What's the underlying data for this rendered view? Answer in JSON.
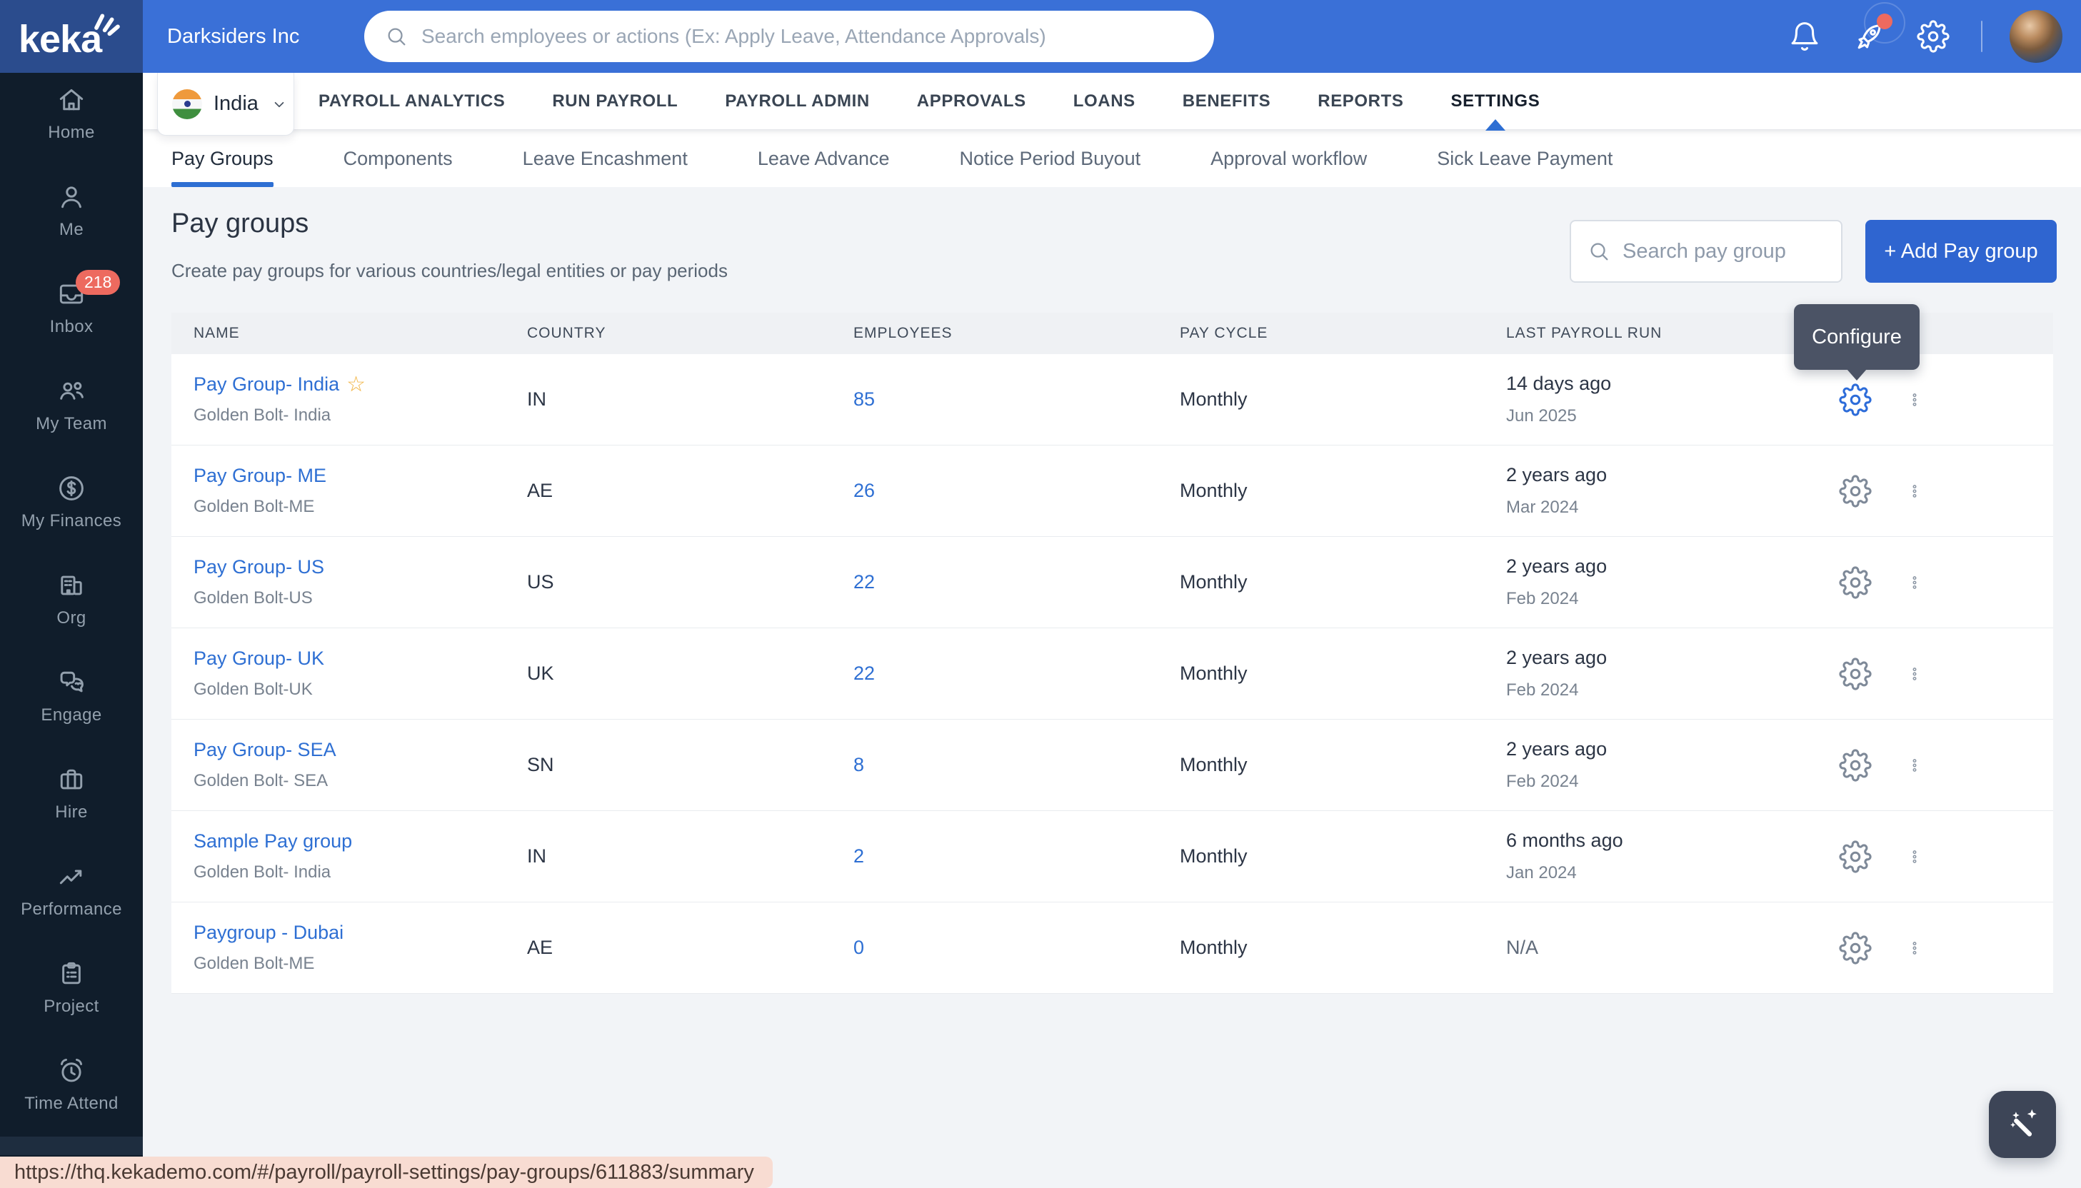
{
  "header": {
    "logo_text": "keka",
    "company_name": "Darksiders Inc",
    "search_placeholder": "Search employees or actions (Ex: Apply Leave, Attendance Approvals)"
  },
  "nav": {
    "region_selector": {
      "label": "India",
      "flag": "india-flag-icon"
    },
    "tabs": [
      "PAYROLL ANALYTICS",
      "RUN PAYROLL",
      "PAYROLL ADMIN",
      "APPROVALS",
      "LOANS",
      "BENEFITS",
      "REPORTS",
      "SETTINGS"
    ],
    "active_tab": "SETTINGS"
  },
  "subnav": {
    "tabs": [
      "Pay Groups",
      "Components",
      "Leave Encashment",
      "Leave Advance",
      "Notice Period Buyout",
      "Approval workflow",
      "Sick Leave Payment"
    ],
    "active_tab": "Pay Groups"
  },
  "page": {
    "title": "Pay groups",
    "subtitle": "Create pay groups for various countries/legal entities or pay periods",
    "search_placeholder": "Search pay group",
    "add_button_label": "+ Add Pay group"
  },
  "tooltip": {
    "label": "Configure"
  },
  "table": {
    "columns": [
      "NAME",
      "COUNTRY",
      "EMPLOYEES",
      "PAY CYCLE",
      "LAST PAYROLL RUN"
    ],
    "rows": [
      {
        "name": "Pay Group- India",
        "starred": true,
        "entity": "Golden Bolt- India",
        "country": "IN",
        "employees": "85",
        "pay_cycle": "Monthly",
        "last_run": "14 days ago",
        "last_run_period": "Jun 2025",
        "gear_active": true
      },
      {
        "name": "Pay Group- ME",
        "starred": false,
        "entity": "Golden Bolt-ME",
        "country": "AE",
        "employees": "26",
        "pay_cycle": "Monthly",
        "last_run": "2 years ago",
        "last_run_period": "Mar 2024",
        "gear_active": false
      },
      {
        "name": "Pay Group- US",
        "starred": false,
        "entity": "Golden Bolt-US",
        "country": "US",
        "employees": "22",
        "pay_cycle": "Monthly",
        "last_run": "2 years ago",
        "last_run_period": "Feb 2024",
        "gear_active": false
      },
      {
        "name": "Pay Group- UK",
        "starred": false,
        "entity": "Golden Bolt-UK",
        "country": "UK",
        "employees": "22",
        "pay_cycle": "Monthly",
        "last_run": "2 years ago",
        "last_run_period": "Feb 2024",
        "gear_active": false
      },
      {
        "name": "Pay Group- SEA",
        "starred": false,
        "entity": "Golden Bolt- SEA",
        "country": "SN",
        "employees": "8",
        "pay_cycle": "Monthly",
        "last_run": "2 years ago",
        "last_run_period": "Feb 2024",
        "gear_active": false
      },
      {
        "name": "Sample Pay group",
        "starred": false,
        "entity": "Golden Bolt- India",
        "country": "IN",
        "employees": "2",
        "pay_cycle": "Monthly",
        "last_run": "6 months ago",
        "last_run_period": "Jan 2024",
        "gear_active": false
      },
      {
        "name": "Paygroup - Dubai",
        "starred": false,
        "entity": "Golden Bolt-ME",
        "country": "AE",
        "employees": "0",
        "pay_cycle": "Monthly",
        "last_run": "N/A",
        "last_run_period": "",
        "gear_active": false
      }
    ]
  },
  "sidebar": {
    "items": [
      {
        "label": "Home",
        "icon": "home-icon"
      },
      {
        "label": "Me",
        "icon": "person-icon"
      },
      {
        "label": "Inbox",
        "icon": "inbox-icon",
        "badge": "218"
      },
      {
        "label": "My Team",
        "icon": "team-icon"
      },
      {
        "label": "My Finances",
        "icon": "finances-icon"
      },
      {
        "label": "Org",
        "icon": "org-icon"
      },
      {
        "label": "Engage",
        "icon": "engage-icon"
      },
      {
        "label": "Hire",
        "icon": "hire-icon"
      },
      {
        "label": "Performance",
        "icon": "performance-icon"
      },
      {
        "label": "Project",
        "icon": "project-icon"
      },
      {
        "label": "Time Attend",
        "icon": "time-attend-icon"
      }
    ]
  },
  "statusbar": {
    "url": "https://thq.kekademo.com/#/payroll/payroll-settings/pay-groups/611883/summary"
  },
  "floating_button": {
    "icon": "magic-wand-icon"
  },
  "colors": {
    "header_blue": "#3a70d7",
    "logo_navy": "#2b4c8d",
    "sidebar_navy": "#101d2b",
    "accent_blue": "#2d6cd9",
    "button_blue": "#2f65d0",
    "link_blue": "#2e6fd3",
    "badge_red": "#ed6a5f",
    "tooltip_slate": "#4b5365",
    "statusbar_pink": "#f8dcd2",
    "star_yellow": "#f1b23e",
    "content_bg": "#f2f4f7"
  }
}
